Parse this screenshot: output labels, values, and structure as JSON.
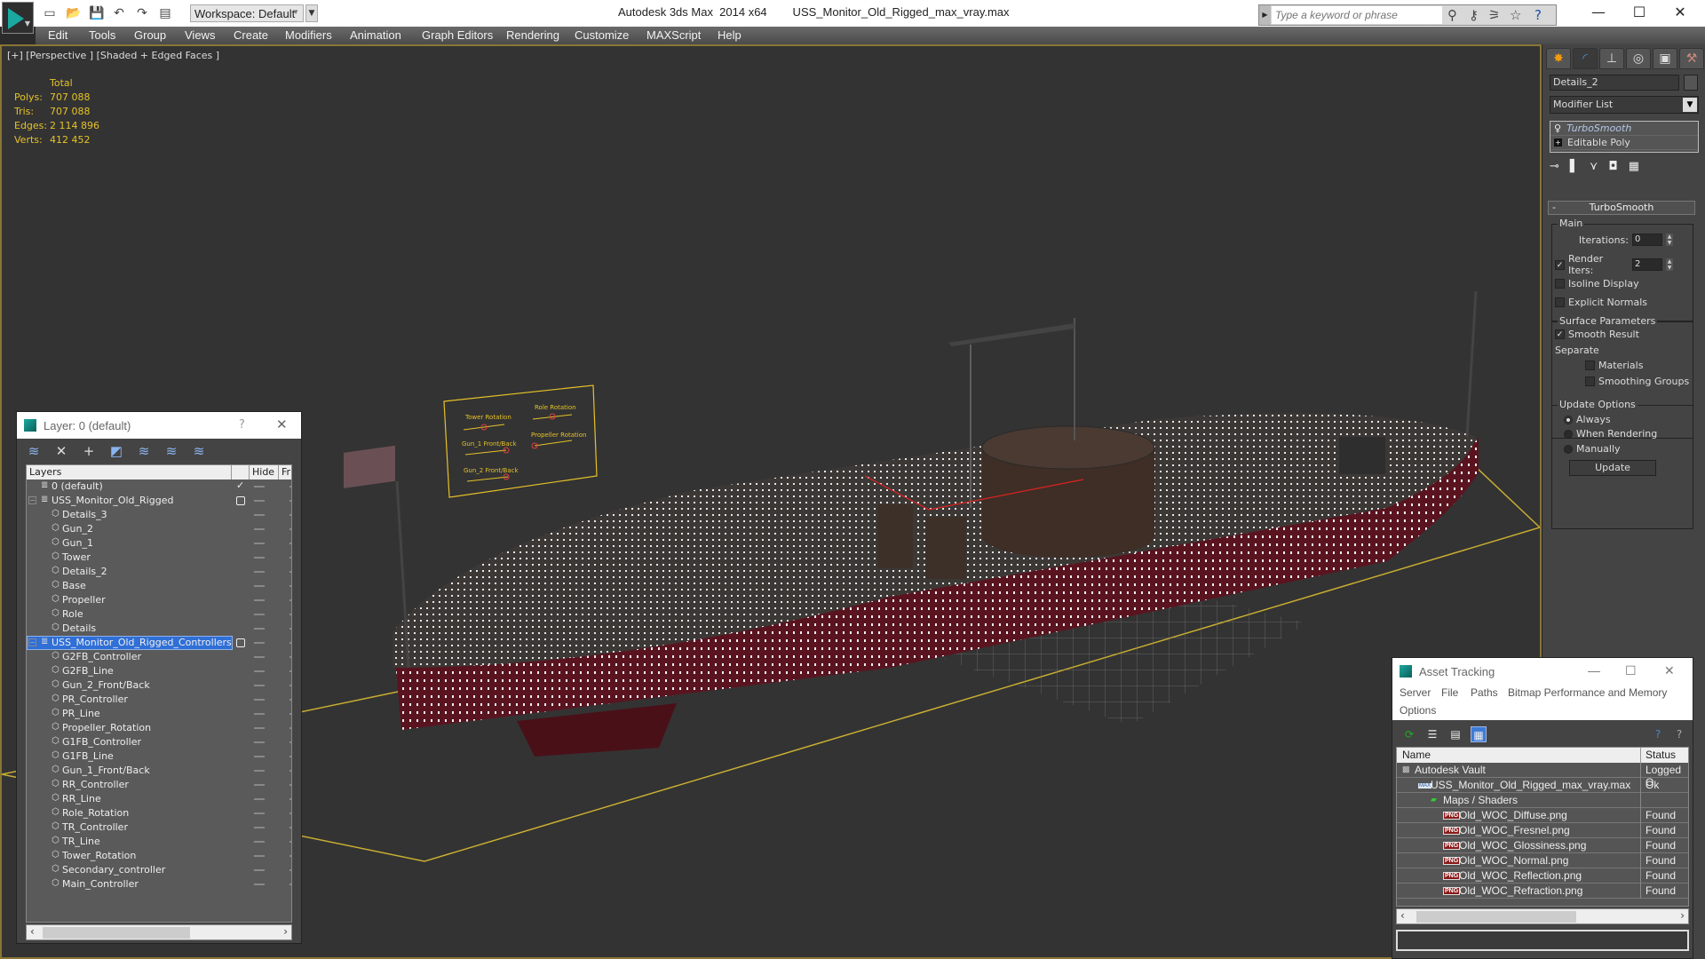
{
  "app": {
    "title": "Autodesk 3ds Max  2014 x64        USS_Monitor_Old_Rigged_max_vray.max",
    "workspace": "Workspace: Default",
    "search_placeholder": "Type a keyword or phrase"
  },
  "menu": [
    "Edit",
    "Tools",
    "Group",
    "Views",
    "Create",
    "Modifiers",
    "Animation",
    "Graph Editors",
    "Rendering",
    "Customize",
    "MAXScript",
    "Help"
  ],
  "viewport": {
    "label": "[+] [Perspective ] [Shaded + Edged Faces ]",
    "stats": {
      "header": "Total",
      "rows": [
        {
          "k": "Polys:",
          "v": "707 088"
        },
        {
          "k": "Tris:",
          "v": "707 088"
        },
        {
          "k": "Edges:",
          "v": "2 114 896"
        },
        {
          "k": "Verts:",
          "v": "412 452"
        }
      ]
    },
    "controller_panel": {
      "sliders": [
        "Tower Rotation",
        "Role Rotation",
        "Gun_1 Front/Back",
        "Propeller Rotation",
        "Gun_2 Front/Back"
      ]
    }
  },
  "command_panel": {
    "tabs": [
      "create-icon",
      "modify-icon",
      "hierarchy-icon",
      "motion-icon",
      "display-icon",
      "utilities-icon"
    ],
    "object_name": "Details_2",
    "modifier_list": "Modifier List",
    "stack": [
      "TurboSmooth",
      "Editable Poly"
    ],
    "rollout_title": "TurboSmooth",
    "main": {
      "title": "Main",
      "iterations_label": "Iterations:",
      "iterations": "0",
      "render_iters_label": "Render Iters:",
      "render_iters": "2",
      "render_iters_checked": true,
      "isoline": "Isoline Display",
      "isoline_checked": false,
      "explicit": "Explicit Normals",
      "explicit_checked": false
    },
    "surface": {
      "title": "Surface Parameters",
      "smooth_result": "Smooth Result",
      "smooth_checked": true,
      "separate": "Separate",
      "materials": "Materials",
      "smoothing_groups": "Smoothing Groups"
    },
    "update": {
      "title": "Update Options",
      "options": [
        "Always",
        "When Rendering",
        "Manually"
      ],
      "selected": "Always",
      "button": "Update"
    }
  },
  "layer_dialog": {
    "title": "Layer: 0 (default)",
    "help": "?",
    "columns": {
      "layers": "Layers",
      "hide": "Hide",
      "freeze": "Fr"
    },
    "rows": [
      {
        "name": "0 (default)",
        "type": "layer",
        "level": 0,
        "current": true
      },
      {
        "name": "USS_Monitor_Old_Rigged",
        "type": "layer",
        "level": 0,
        "expanded": true
      },
      {
        "name": "Details_3",
        "type": "object",
        "level": 1
      },
      {
        "name": "Gun_2",
        "type": "object",
        "level": 1
      },
      {
        "name": "Gun_1",
        "type": "object",
        "level": 1
      },
      {
        "name": "Tower",
        "type": "object",
        "level": 1
      },
      {
        "name": "Details_2",
        "type": "object",
        "level": 1
      },
      {
        "name": "Base",
        "type": "object",
        "level": 1
      },
      {
        "name": "Propeller",
        "type": "object",
        "level": 1
      },
      {
        "name": "Role",
        "type": "object",
        "level": 1
      },
      {
        "name": "Details",
        "type": "object",
        "level": 1
      },
      {
        "name": "USS_Monitor_Old_Rigged_Controllers",
        "type": "layer",
        "level": 0,
        "expanded": true,
        "selected": true
      },
      {
        "name": "G2FB_Controller",
        "type": "object",
        "level": 1
      },
      {
        "name": "G2FB_Line",
        "type": "object",
        "level": 1
      },
      {
        "name": "Gun_2_Front/Back",
        "type": "object",
        "level": 1
      },
      {
        "name": "PR_Controller",
        "type": "object",
        "level": 1
      },
      {
        "name": "PR_Line",
        "type": "object",
        "level": 1
      },
      {
        "name": "Propeller_Rotation",
        "type": "object",
        "level": 1
      },
      {
        "name": "G1FB_Controller",
        "type": "object",
        "level": 1
      },
      {
        "name": "G1FB_Line",
        "type": "object",
        "level": 1
      },
      {
        "name": "Gun_1_Front/Back",
        "type": "object",
        "level": 1
      },
      {
        "name": "RR_Controller",
        "type": "object",
        "level": 1
      },
      {
        "name": "RR_Line",
        "type": "object",
        "level": 1
      },
      {
        "name": "Role_Rotation",
        "type": "object",
        "level": 1
      },
      {
        "name": "TR_Controller",
        "type": "object",
        "level": 1
      },
      {
        "name": "TR_Line",
        "type": "object",
        "level": 1
      },
      {
        "name": "Tower_Rotation",
        "type": "object",
        "level": 1
      },
      {
        "name": "Secondary_controller",
        "type": "object",
        "level": 1
      },
      {
        "name": "Main_Controller",
        "type": "object",
        "level": 1
      }
    ]
  },
  "asset_tracking": {
    "title": "Asset Tracking",
    "menu": [
      "Server",
      "File",
      "Paths",
      "Bitmap Performance and Memory",
      "Options"
    ],
    "columns": {
      "name": "Name",
      "status": "Status"
    },
    "rows": [
      {
        "name": "Autodesk Vault",
        "status": "Logged O",
        "icon": "vault-icon",
        "level": 0
      },
      {
        "name": "USS_Monitor_Old_Rigged_max_vray.max",
        "status": "Ok",
        "icon": "max-file-icon",
        "level": 1
      },
      {
        "name": "Maps / Shaders",
        "status": "",
        "icon": "maps-icon",
        "level": 2
      },
      {
        "name": "Old_WOC_Diffuse.png",
        "status": "Found",
        "icon": "png-icon",
        "level": 3
      },
      {
        "name": "Old_WOC_Fresnel.png",
        "status": "Found",
        "icon": "png-icon",
        "level": 3
      },
      {
        "name": "Old_WOC_Glossiness.png",
        "status": "Found",
        "icon": "png-icon",
        "level": 3
      },
      {
        "name": "Old_WOC_Normal.png",
        "status": "Found",
        "icon": "png-icon",
        "level": 3
      },
      {
        "name": "Old_WOC_Reflection.png",
        "status": "Found",
        "icon": "png-icon",
        "level": 3
      },
      {
        "name": "Old_WOC_Refraction.png",
        "status": "Found",
        "icon": "png-icon",
        "level": 3
      }
    ]
  }
}
